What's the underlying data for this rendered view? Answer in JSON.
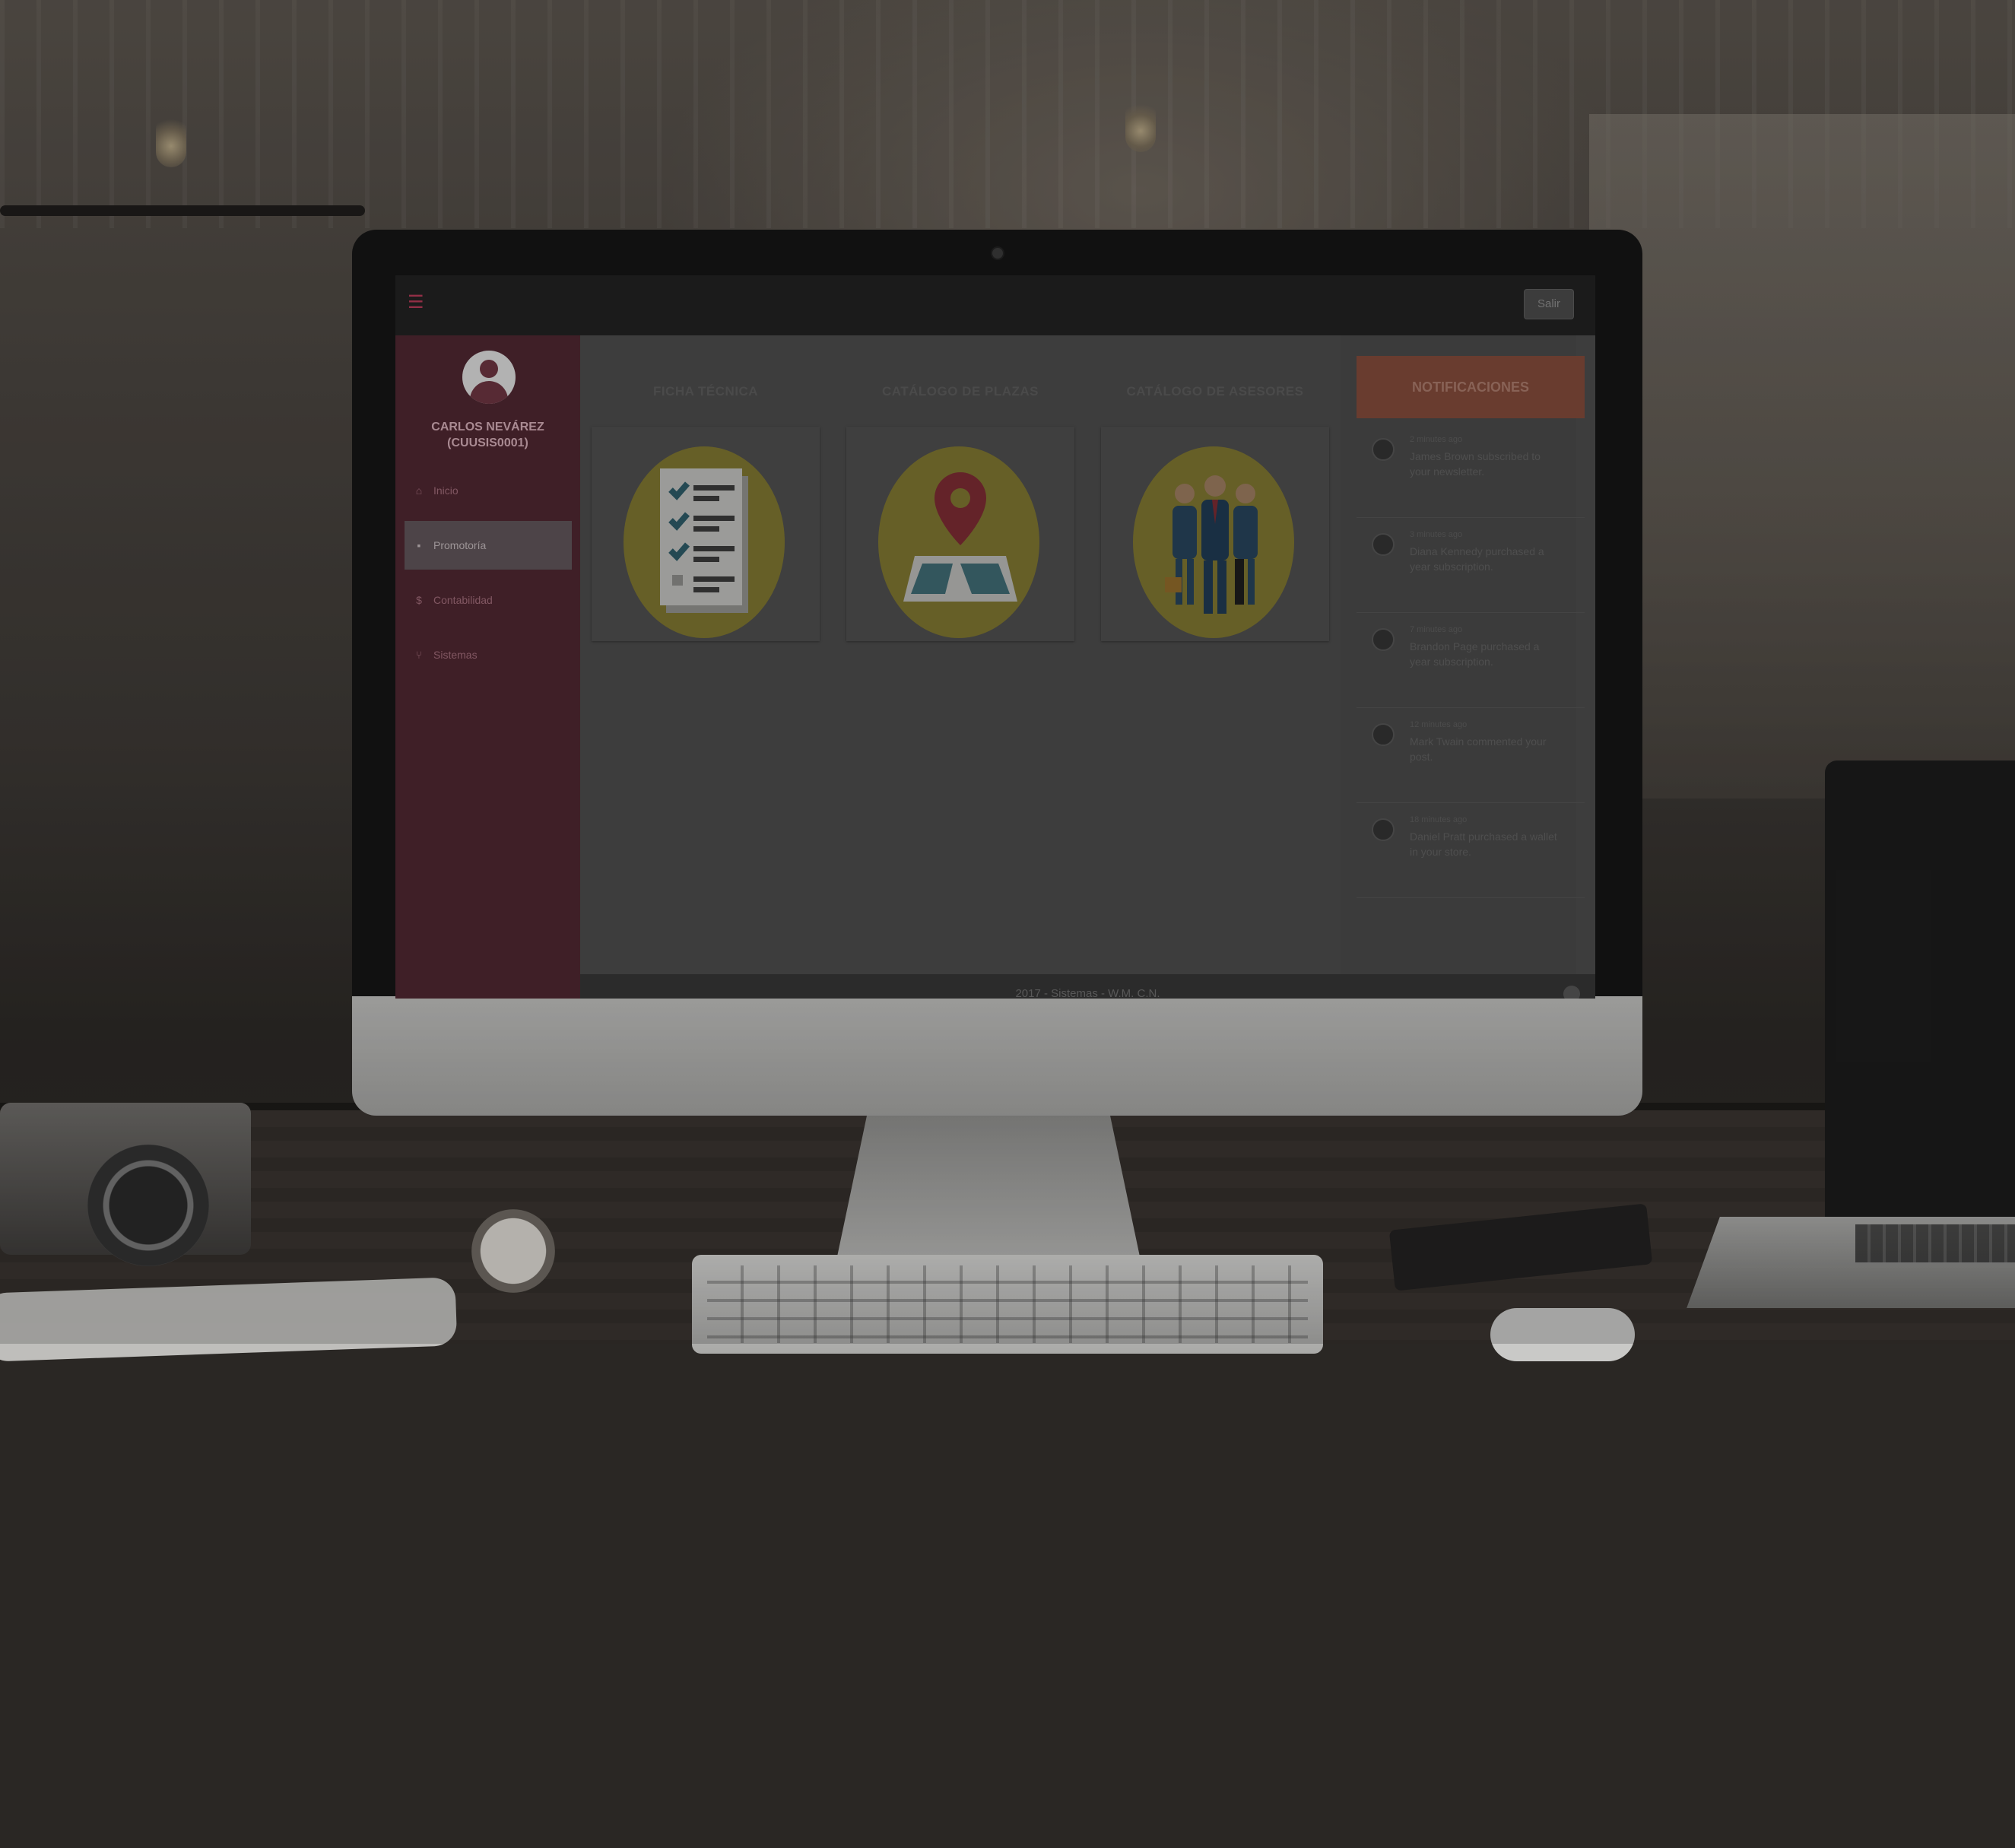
{
  "topbar": {
    "menu_icon": "hamburger-icon",
    "exit_label": "Salir"
  },
  "user": {
    "name": "CARLOS NEVÁREZ",
    "code": "(CUUSIS0001)"
  },
  "sidebar": {
    "items": [
      {
        "label": "Inicio",
        "icon": "home-icon",
        "active": false
      },
      {
        "label": "Promotoría",
        "icon": "briefcase-icon",
        "active": true
      },
      {
        "label": "Contabilidad",
        "icon": "dollar-icon",
        "active": false
      },
      {
        "label": "Sistemas",
        "icon": "branch-icon",
        "active": false
      }
    ]
  },
  "cards": [
    {
      "title": "FICHA TÉCNICA",
      "icon": "checklist-icon"
    },
    {
      "title": "CATÁLOGO DE PLAZAS",
      "icon": "map-pin-icon"
    },
    {
      "title": "CATÁLOGO DE ASESORES",
      "icon": "people-icon"
    }
  ],
  "notifications": {
    "title": "NOTIFICACIONES",
    "items": [
      {
        "time": "2 minutes ago",
        "text": "James Brown subscribed to your newsletter."
      },
      {
        "time": "3 minutes ago",
        "text": "Diana Kennedy purchased a year subscription."
      },
      {
        "time": "7 minutes ago",
        "text": "Brandon Page purchased a year subscription."
      },
      {
        "time": "12 minutes ago",
        "text": "Mark Twain commented your post."
      },
      {
        "time": "18 minutes ago",
        "text": "Daniel Pratt purchased a wallet in your store."
      }
    ]
  },
  "footer": {
    "text": "2017 - Sistemas - W.M. C.N."
  },
  "colors": {
    "sidebar": "#4e2630",
    "notif_header": "#804a3a",
    "topbar": "#222222",
    "circle": "#7d7430"
  }
}
